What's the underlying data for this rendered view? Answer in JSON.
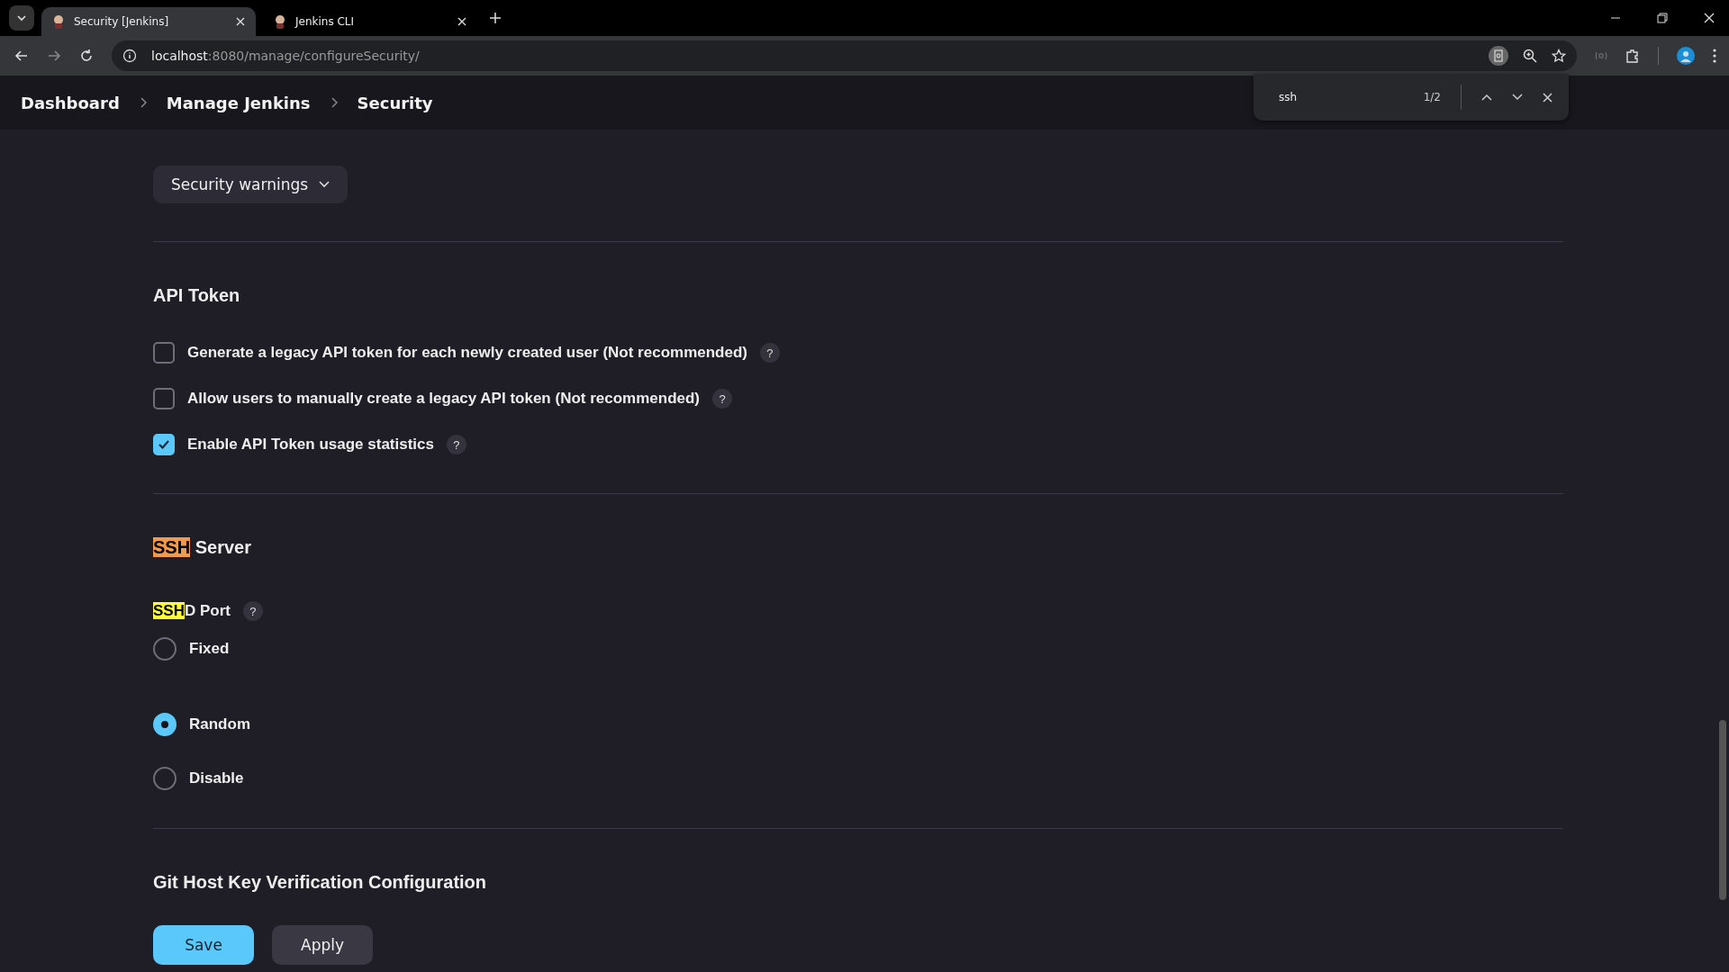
{
  "browser": {
    "tabs": [
      {
        "title": "Security [Jenkins]",
        "selected": true
      },
      {
        "title": "Jenkins CLI",
        "selected": false
      }
    ],
    "address": {
      "host": "localhost",
      "path": ":8080/manage/configureSecurity/"
    },
    "find_bar": {
      "query": "ssh",
      "count": "1/2"
    }
  },
  "breadcrumb": [
    "Dashboard",
    "Manage Jenkins",
    "Security"
  ],
  "security_warnings": "Security warnings",
  "api_token": {
    "heading": "API Token",
    "options": [
      {
        "label": "Generate a legacy API token for each newly created user (Not recommended)",
        "checked": false,
        "help": "?"
      },
      {
        "label": "Allow users to manually create a legacy API token (Not recommended)",
        "checked": false,
        "help": "?"
      },
      {
        "label": "Enable API Token usage statistics",
        "checked": true,
        "help": "?"
      }
    ]
  },
  "ssh_server": {
    "heading": {
      "match": "SSH",
      "rest": " Server",
      "current": true
    },
    "port_label": {
      "match": "SSH",
      "rest": "D Port",
      "current": false,
      "help": "?"
    },
    "options": [
      {
        "label": "Fixed",
        "selected": false
      },
      {
        "label": "Random",
        "selected": true
      },
      {
        "label": "Disable",
        "selected": false
      }
    ]
  },
  "git": {
    "heading": "Git Host Key Verification Configuration"
  },
  "buttons": {
    "save": "Save",
    "apply": "Apply"
  }
}
